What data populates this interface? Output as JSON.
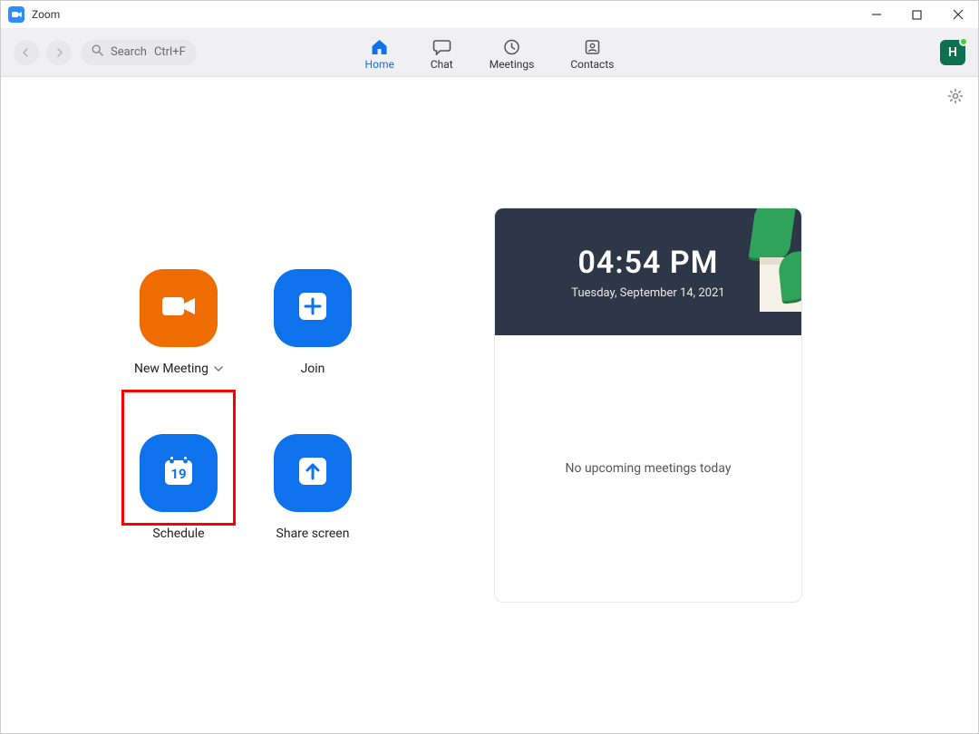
{
  "title": "Zoom",
  "search": {
    "label": "Search",
    "shortcut": "Ctrl+F"
  },
  "tabs": {
    "home": "Home",
    "chat": "Chat",
    "meetings": "Meetings",
    "contacts": "Contacts",
    "active": "home"
  },
  "avatar": {
    "initial": "H"
  },
  "actions": {
    "new_meeting": "New Meeting",
    "join": "Join",
    "schedule": "Schedule",
    "schedule_day": "19",
    "share_screen": "Share screen"
  },
  "clock": {
    "time": "04:54 PM",
    "date": "Tuesday, September 14, 2021"
  },
  "upcoming": {
    "empty": "No upcoming meetings today"
  },
  "colors": {
    "blue": "#0e72ed",
    "orange": "#ef6c00",
    "avatar_bg": "#0d704f",
    "highlight": "#ff0000"
  },
  "highlight_target": "schedule-button"
}
